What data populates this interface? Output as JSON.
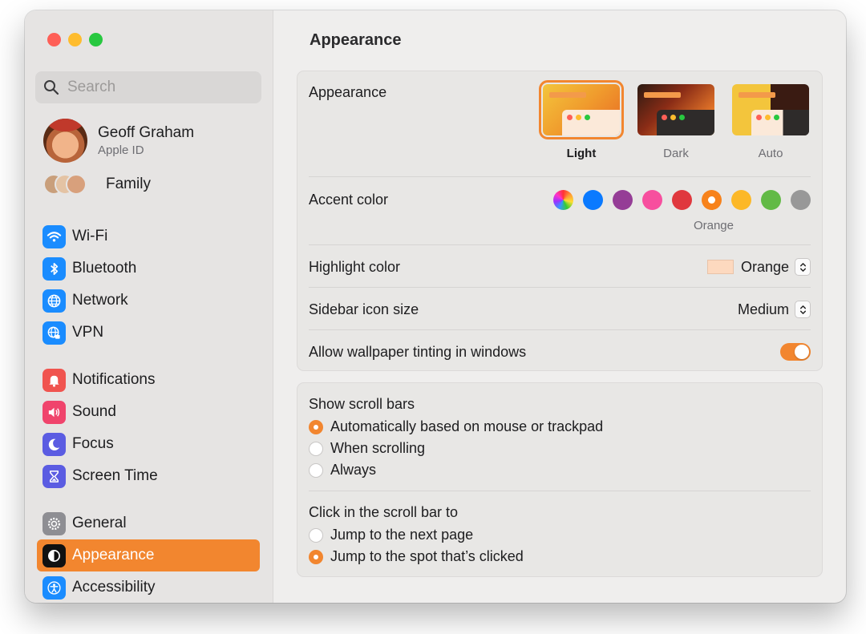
{
  "sidebar": {
    "search_placeholder": "Search",
    "profile": {
      "name": "Geoff Graham",
      "subtitle": "Apple ID"
    },
    "family_label": "Family",
    "items": [
      {
        "label": "Wi-Fi",
        "icon": "wifi-icon",
        "color": "#1a8cff"
      },
      {
        "label": "Bluetooth",
        "icon": "bluetooth-icon",
        "color": "#1a8cff"
      },
      {
        "label": "Network",
        "icon": "globe-icon",
        "color": "#1a8cff"
      },
      {
        "label": "VPN",
        "icon": "vpn-globe-icon",
        "color": "#1a8cff"
      },
      {
        "label": "Notifications",
        "icon": "bell-icon",
        "color": "#f0544f"
      },
      {
        "label": "Sound",
        "icon": "speaker-icon",
        "color": "#f0446c"
      },
      {
        "label": "Focus",
        "icon": "moon-icon",
        "color": "#5b5ce2"
      },
      {
        "label": "Screen Time",
        "icon": "hourglass-icon",
        "color": "#5b5ce2"
      },
      {
        "label": "General",
        "icon": "gear-icon",
        "color": "#8e8e93"
      },
      {
        "label": "Appearance",
        "icon": "appearance-icon",
        "color": "#111111"
      },
      {
        "label": "Accessibility",
        "icon": "accessibility-icon",
        "color": "#1a8cff"
      }
    ]
  },
  "main": {
    "title": "Appearance",
    "appearance": {
      "label": "Appearance",
      "options": [
        "Light",
        "Dark",
        "Auto"
      ],
      "selected": "Light"
    },
    "accent": {
      "label": "Accent color",
      "selected_name": "Orange",
      "colors": [
        "multicolor",
        "#0a7aff",
        "#953d96",
        "#f74f9e",
        "#e0383e",
        "#f7821b",
        "#fcb827",
        "#62ba46",
        "#989898"
      ]
    },
    "highlight": {
      "label": "Highlight color",
      "value": "Orange",
      "swatch": "#fdd9bf"
    },
    "sidebar_icon_size": {
      "label": "Sidebar icon size",
      "value": "Medium"
    },
    "wallpaper_tinting": {
      "label": "Allow wallpaper tinting in windows",
      "enabled": true
    },
    "scroll_bars": {
      "label": "Show scroll bars",
      "options": [
        "Automatically based on mouse or trackpad",
        "When scrolling",
        "Always"
      ],
      "selected": 0
    },
    "click_scroll": {
      "label": "Click in the scroll bar to",
      "options": [
        "Jump to the next page",
        "Jump to the spot that’s clicked"
      ],
      "selected": 1
    }
  },
  "colors": {
    "accent": "#f2862f"
  }
}
